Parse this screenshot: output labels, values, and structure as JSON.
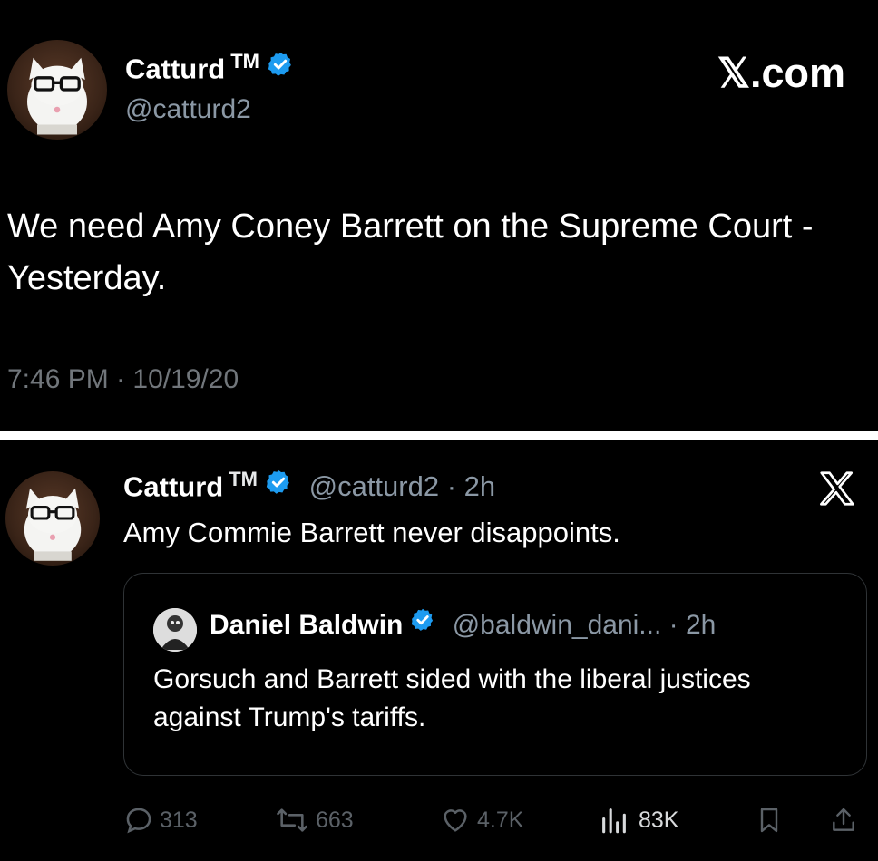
{
  "tweet_old": {
    "display_name": "Catturd",
    "tm": "TM",
    "handle": "@catturd2",
    "brand": "𝕏.com",
    "text": "We need Amy Coney Barrett on the Supreme Court - Yesterday.",
    "timestamp": "7:46 PM · 10/19/20"
  },
  "tweet_new": {
    "display_name": "Catturd",
    "tm": "TM",
    "meta": "@catturd2 · 2h",
    "text": "Amy Commie Barrett never disappoints.",
    "quote": {
      "display_name": "Daniel Baldwin",
      "meta": "@baldwin_dani... · 2h",
      "text": "Gorsuch and Barrett sided with the liberal justices against Trump's tariffs."
    },
    "actions": {
      "replies": "313",
      "reposts": "663",
      "likes": "4.7K",
      "views": "83K"
    }
  },
  "colors": {
    "background": "#000000",
    "verified_badge": "#1d9bf0",
    "secondary_text": "#8b98a5",
    "divider": "#ffffff"
  },
  "icons": [
    "verified-badge-icon",
    "x-logo-icon",
    "reply-icon",
    "repost-icon",
    "like-icon",
    "views-icon",
    "bookmark-icon",
    "share-icon"
  ]
}
